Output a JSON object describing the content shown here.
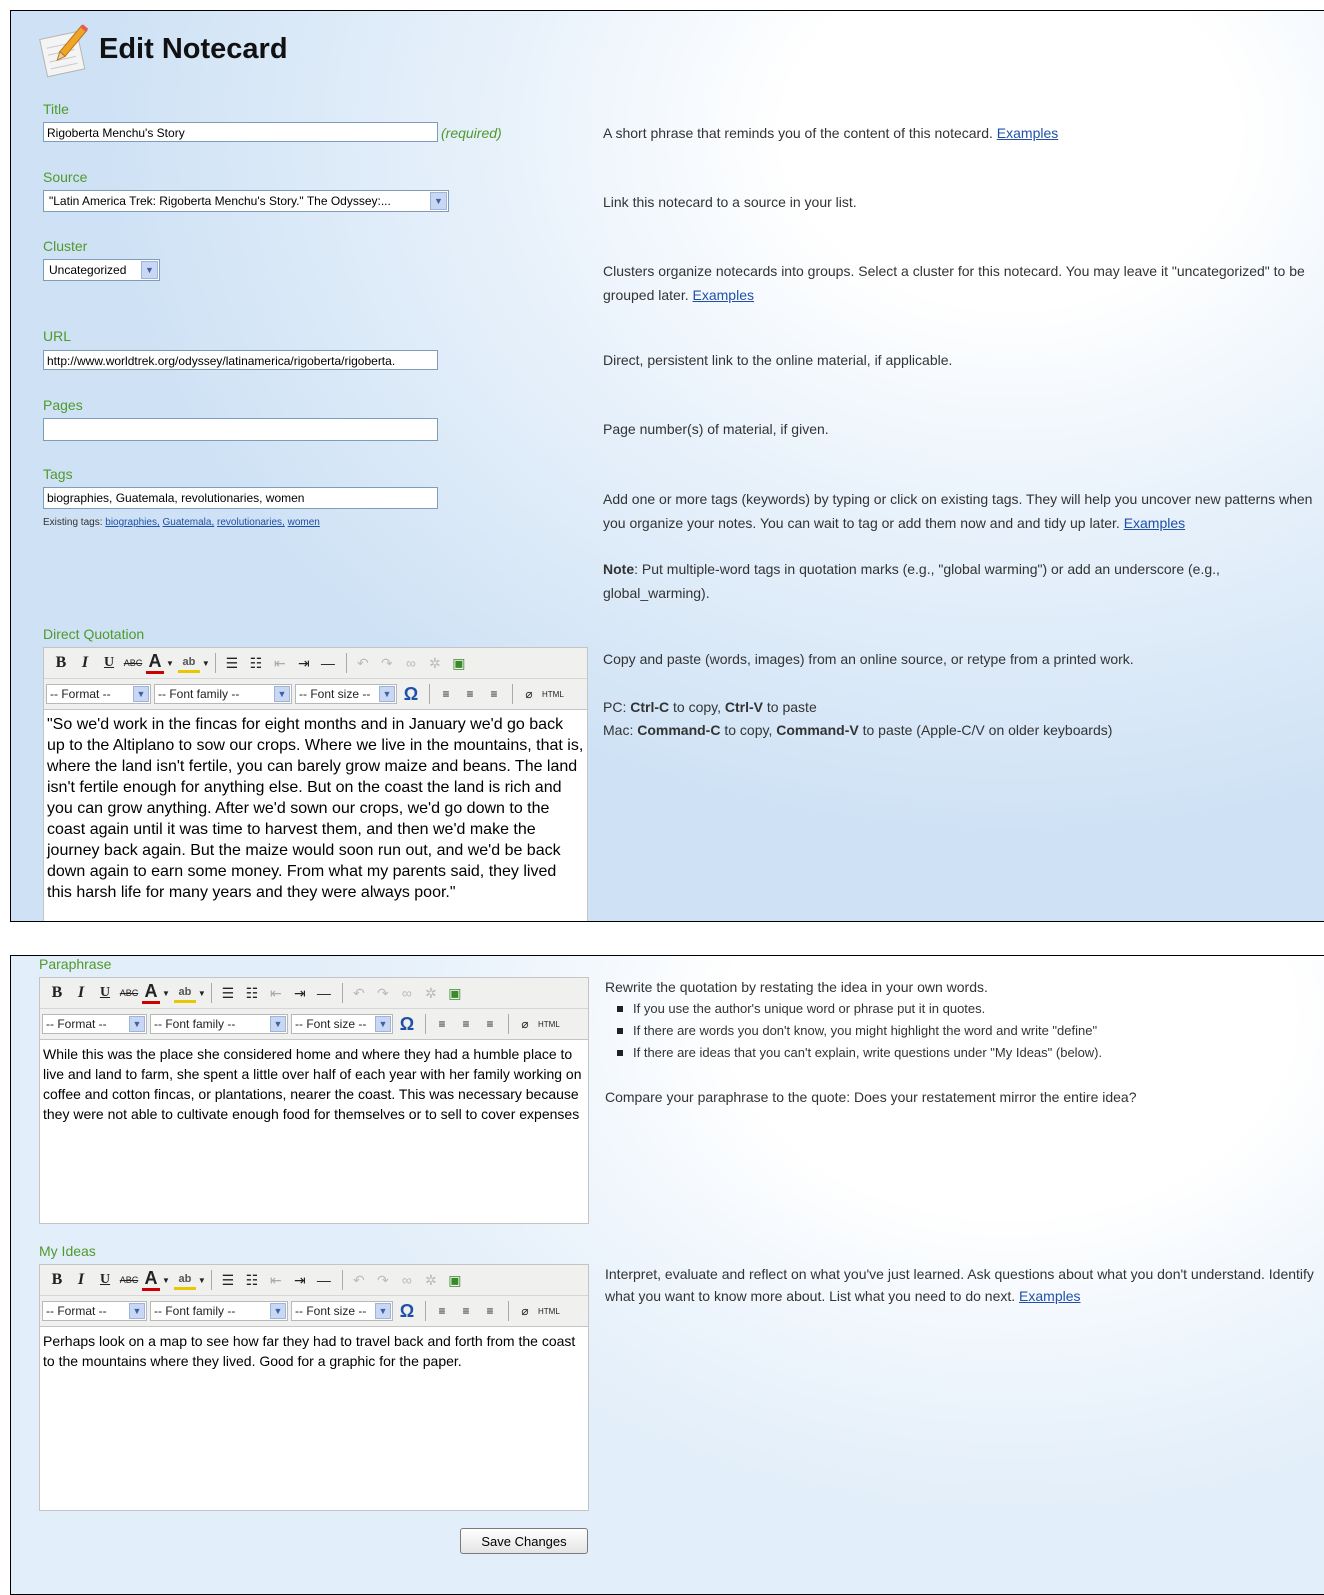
{
  "page": {
    "title": "Edit Notecard",
    "required_hint": "(required)"
  },
  "fields": {
    "title": {
      "label": "Title",
      "value": "Rigoberta Menchu's Story",
      "help": "A short phrase that reminds you of the content of this notecard.",
      "help_link": "Examples"
    },
    "source": {
      "label": "Source",
      "value": "\"Latin America Trek: Rigoberta Menchu's Story.\" The Odyssey:...",
      "help": "Link this notecard to a source in your list."
    },
    "cluster": {
      "label": "Cluster",
      "value": "Uncategorized",
      "help": "Clusters organize notecards into groups. Select a cluster for this notecard. You may leave it \"uncategorized\" to be grouped later.",
      "help_link": "Examples"
    },
    "url": {
      "label": "URL",
      "value": "http://www.worldtrek.org/odyssey/latinamerica/rigoberta/rigoberta.",
      "help": "Direct, persistent link to the online material, if applicable."
    },
    "pages": {
      "label": "Pages",
      "value": "",
      "help": "Page number(s) of material, if given."
    },
    "tags": {
      "label": "Tags",
      "value": "biographies, Guatemala, revolutionaries, women",
      "existing_label": "Existing tags:",
      "existing": [
        "biographies,",
        "Guatemala,",
        "revolutionaries,",
        "women"
      ],
      "help": "Add one or more tags (keywords) by typing or click on existing tags. They will help you uncover new patterns when you organize your notes. You can wait to tag or add them now and and tidy up later.",
      "help_link": "Examples",
      "note_bold": "Note",
      "note_text": ": Put multiple-word tags in quotation marks (e.g., \"global warming\") or add an underscore (e.g., global_warming)."
    }
  },
  "toolbar": {
    "format": "-- Format --",
    "font_family": "-- Font family --",
    "font_size": "-- Font size --",
    "html": "HTML",
    "bold": "B",
    "italic": "I",
    "underline": "U",
    "strike": "ABC",
    "font_color": "A",
    "omega": "Ω"
  },
  "quotation": {
    "label": "Direct Quotation",
    "content": "\"So we'd work in the fincas for eight months and in January we'd go back up to the Altiplano to sow our crops. Where we live in the mountains, that is, where the land isn't fertile, you can barely grow maize and beans. The land isn't fertile enough for anything else. But on the coast the land is rich and you can grow anything. After we'd sown our crops, we'd go down to the coast again until it was time to harvest them, and then we'd make the journey back again. But the maize would soon run out, and we'd be back down again to earn some money. From what my parents said, they lived this harsh life for many years and they were always poor.\"",
    "help": "Copy and paste (words, images) from an online source, or retype from a printed work.",
    "pc_prefix": "PC: ",
    "pc_copy": "Ctrl-C",
    "pc_mid": " to copy, ",
    "pc_paste": "Ctrl-V",
    "pc_suffix": " to paste",
    "mac_prefix": "Mac: ",
    "mac_copy": "Command-C",
    "mac_mid": " to copy, ",
    "mac_paste": "Command-V",
    "mac_suffix": " to paste (Apple-C/V on older keyboards)"
  },
  "paraphrase": {
    "label": "Paraphrase",
    "content": "While this was the place she considered home and where they had a humble place to live and land to farm, she spent a little over half of each year with her family working on coffee and cotton fincas, or plantations, nearer the coast. This was necessary because they were not able to cultivate enough food for themselves or to sell to cover expenses",
    "help": "Rewrite the quotation by restating the idea in your own words.",
    "bullets": [
      "If you use the author's unique word or phrase put it in quotes.",
      "If there are words you don't know, you might highlight the word and write \"define\"",
      "If there are ideas that you can't explain, write questions under \"My Ideas\" (below)."
    ],
    "compare": "Compare your paraphrase to the quote: Does your restatement mirror the entire idea?"
  },
  "ideas": {
    "label": "My Ideas",
    "content": "Perhaps look on a map to see how far they had to travel back and forth from the coast to the mountains where they lived. Good for a graphic for the paper.",
    "help": "Interpret, evaluate and reflect on what you've just learned. Ask questions about what you don't understand. Identify what you want to know more about. List what you need to do next.",
    "help_link": "Examples"
  },
  "actions": {
    "save": "Save Changes"
  },
  "colors": {
    "label_green": "#4f9a2b",
    "link_blue": "#1f50a8",
    "input_border": "#7f9db9"
  }
}
